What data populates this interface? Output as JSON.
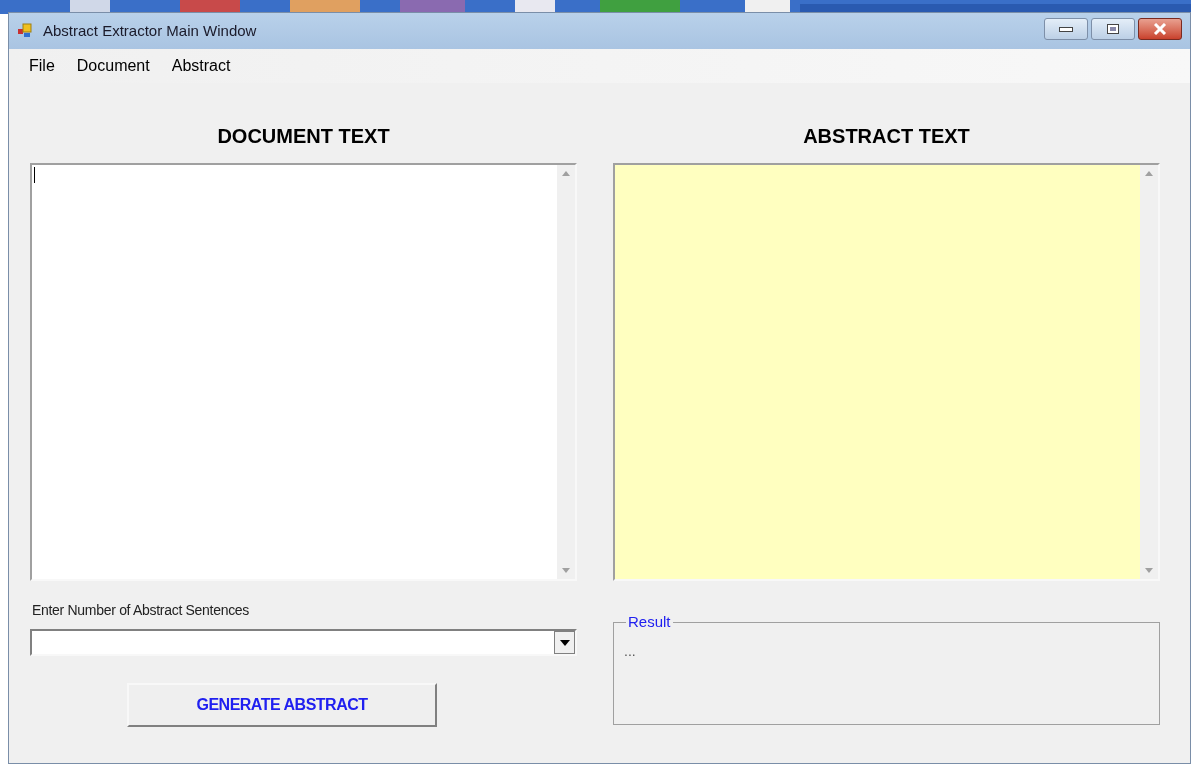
{
  "window": {
    "title": "Abstract Extractor Main Window"
  },
  "menu": [
    "File",
    "Document",
    "Abstract"
  ],
  "document_panel": {
    "heading": "DOCUMENT TEXT",
    "sentences_label": "Enter Number of Abstract Sentences",
    "button": "GENERATE ABSTRACT"
  },
  "abstract_panel": {
    "heading": "ABSTRACT TEXT",
    "result_group": {
      "title": "Result",
      "text": "..."
    }
  }
}
